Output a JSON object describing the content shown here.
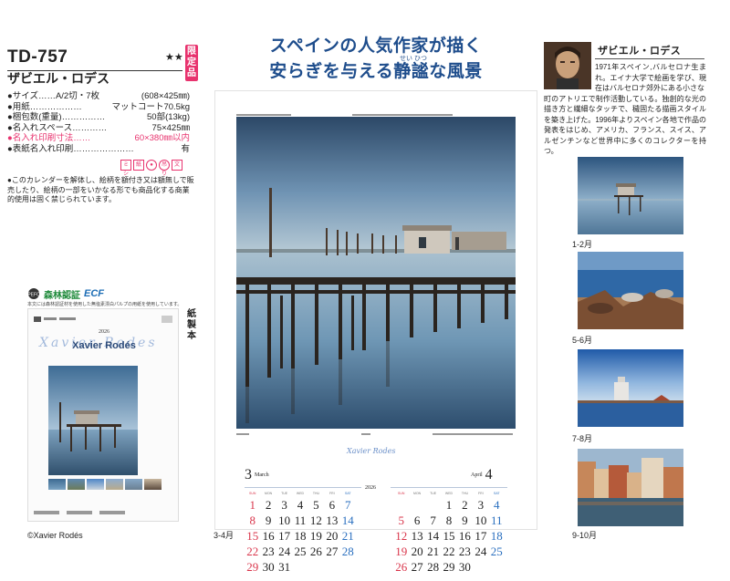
{
  "product": {
    "code": "TD-757",
    "stars": "★★",
    "limited": "限定品",
    "title": "ザビエル・ロデス"
  },
  "specs": [
    {
      "label": "●サイズ……A/2切・7枚",
      "value": "(608×425㎜)",
      "pink": false
    },
    {
      "label": "●用紙………………",
      "value": "マットコート70.5kg",
      "pink": false
    },
    {
      "label": "●梱包数(重量)……………",
      "value": "50部(13kg)",
      "pink": false
    },
    {
      "label": "●名入れスペース…………",
      "value": "75×425㎜",
      "pink": false
    },
    {
      "label": "●名入れ印刷寸法……",
      "value": "60×380㎜以内",
      "pink": true
    },
    {
      "label": "●表紙名入れ印刷…………………",
      "value": "有",
      "pink": false
    }
  ],
  "badges": [
    "ミシ",
    "紙",
    "●",
    "吊り",
    "文"
  ],
  "notes": "●このカレンダーを解体し、絵柄を額付き又は額無しで販売したり、絵柄の一部をいかなる形でも商品化する商業的使用は固く禁じられています。",
  "certification": {
    "mark": "PEFC",
    "forest": "森林認証",
    "ecf": "ECF",
    "note": "本文には森林認証材を使用した無塩素漂白パルプの用紙を使用しています。"
  },
  "thumb": {
    "year": "2026",
    "script": "Xavier Rodes",
    "name": "Xavier Rodés"
  },
  "binding": "紙製本",
  "copyright": "©Xavier Rodés",
  "headline": {
    "line1": "スペインの人気作家が描く",
    "line2": "安らぎを与える静謐な風景",
    "ruby": "せい ひつ"
  },
  "sheet": {
    "signature": "Xavier Rodes",
    "year": "2026",
    "label": "3-4月",
    "months": [
      {
        "num": "3",
        "name": "March",
        "dow": [
          "SUN",
          "MON",
          "TUE",
          "WED",
          "THU",
          "FRI",
          "SAT"
        ],
        "days": [
          "1",
          "2",
          "3",
          "4",
          "5",
          "6",
          "7",
          "8",
          "9",
          "10",
          "11",
          "12",
          "13",
          "14",
          "15",
          "16",
          "17",
          "18",
          "19",
          "20",
          "21",
          "22",
          "23",
          "24",
          "25",
          "26",
          "27",
          "28",
          "29",
          "30",
          "31"
        ]
      },
      {
        "num": "4",
        "name": "April",
        "dow": [
          "SUN",
          "MON",
          "TUE",
          "WED",
          "THU",
          "FRI",
          "SAT"
        ],
        "days": [
          "",
          "",
          "",
          "1",
          "2",
          "3",
          "4",
          "5",
          "6",
          "7",
          "8",
          "9",
          "10",
          "11",
          "12",
          "13",
          "14",
          "15",
          "16",
          "17",
          "18",
          "19",
          "20",
          "21",
          "22",
          "23",
          "24",
          "25",
          "26",
          "27",
          "28",
          "29",
          "30"
        ]
      }
    ]
  },
  "artist": {
    "name": "ザビエル・ロデス",
    "bio_head": "1971年スペイン,バルセロナ生まれ。エイナ大学で絵画を学び、現在はバルセロナ郊外にある小さな",
    "bio_body": "町のアトリエで制作活動している。独創的な光の描き方と繊細なタッチで、穢固たる描画スタイルを築き上げた。1996年よりスペイン各地で作品の発表をはじめ、アメリカ、フランス、スイス、アルゼンチンなど世界中に多くのコレクターを持つ。"
  },
  "months_side": [
    {
      "label": "1-2月"
    },
    {
      "label": "5-6月"
    },
    {
      "label": "7-8月"
    },
    {
      "label": "9-10月"
    }
  ]
}
